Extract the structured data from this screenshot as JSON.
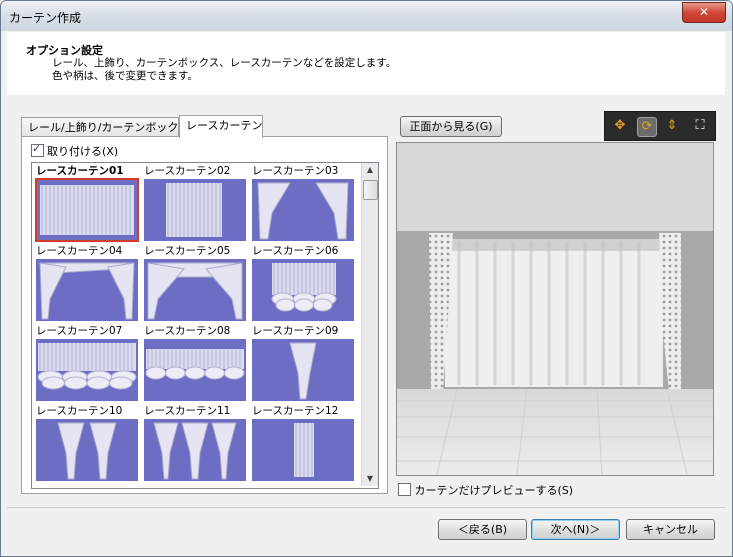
{
  "window": {
    "title": "カーテン作成",
    "close_label": "✕"
  },
  "header": {
    "title": "オプション設定",
    "description": "レール、上飾り、カーテンボックス、レースカーテンなどを設定します。\n色や柄は、後で変更できます。"
  },
  "tabs": [
    {
      "label": "レール/上飾り/カーテンボックス",
      "active": false
    },
    {
      "label": "レースカーテン",
      "active": true
    }
  ],
  "attach_checkbox": {
    "label": "取り付ける(X)",
    "checked": true
  },
  "gallery": {
    "items": [
      {
        "caption": "レースカーテン01",
        "style": "straight-full",
        "selected": true
      },
      {
        "caption": "レースカーテン02",
        "style": "straight-center",
        "selected": false
      },
      {
        "caption": "レースカーテン03",
        "style": "tied-sides",
        "selected": false
      },
      {
        "caption": "レースカーテン04",
        "style": "cross-drape",
        "selected": false
      },
      {
        "caption": "レースカーテン05",
        "style": "swag-drape",
        "selected": false
      },
      {
        "caption": "レースカーテン06",
        "style": "balloon",
        "selected": false
      },
      {
        "caption": "レースカーテン07",
        "style": "balloon-wide",
        "selected": false
      },
      {
        "caption": "レースカーテン08",
        "style": "balloon-short",
        "selected": false
      },
      {
        "caption": "レースカーテン09",
        "style": "single-tie",
        "selected": false
      },
      {
        "caption": "レースカーテン10",
        "style": "pair-tie",
        "selected": false
      },
      {
        "caption": "レースカーテン11",
        "style": "triple-tie",
        "selected": false
      },
      {
        "caption": "レースカーテン12",
        "style": "single-panel",
        "selected": false
      }
    ],
    "thumb_color": "#6d6dc4",
    "selected_color": "#d23c2c"
  },
  "preview": {
    "front_view_label": "正面から見る(G)",
    "tools": [
      {
        "name": "move-icon",
        "glyph": "✥",
        "active": false
      },
      {
        "name": "rotate-icon",
        "glyph": "⟳",
        "active": true
      },
      {
        "name": "vertical-move-icon",
        "glyph": "⇕",
        "active": false
      },
      {
        "name": "fit-icon",
        "glyph": "⛶",
        "active": false
      }
    ],
    "curtain_only_label": "カーテンだけプレビューする(S)",
    "curtain_only_checked": false
  },
  "footer": {
    "back_label": "＜戻る(B)",
    "next_label": "次へ(N)＞",
    "cancel_label": "キャンセル"
  }
}
